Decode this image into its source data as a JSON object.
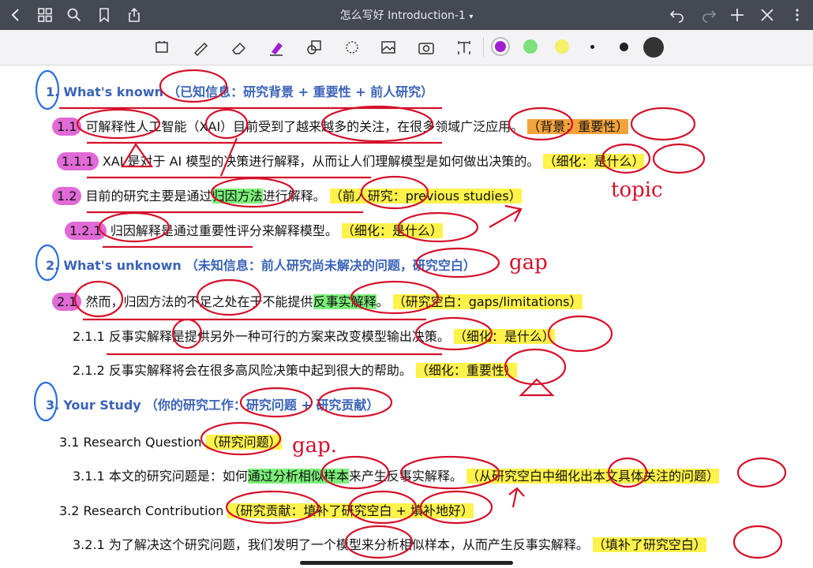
{
  "header": {
    "title": "怎么写好 Introduction-1",
    "colors": {
      "bar": "#454a52",
      "toolbar": "#f3f3f5"
    }
  },
  "toolbar": {
    "left_icons": [
      "back-icon",
      "grid-icon",
      "search-icon",
      "bookmark-icon",
      "share-icon"
    ],
    "right_icons": [
      "undo-icon",
      "redo-icon",
      "add-icon",
      "close-edit-icon"
    ],
    "tools": [
      "lasso-icon",
      "pen-icon",
      "eraser-icon",
      "highlighter-icon",
      "shapes-icon",
      "select-icon",
      "image-icon",
      "camera-icon",
      "text-icon"
    ],
    "swatches": [
      "#a020d0",
      "#7ee07a",
      "#f5ef6a",
      "#222222",
      "#222222",
      "#222222"
    ]
  },
  "content": {
    "s1": {
      "heading_num": "1.",
      "heading_en": "What's known",
      "heading_zh": "（已知信息：研究背景 + 重要性 + 前人研究）",
      "l1_num": "1.1",
      "l1_text": "可解释性人工智能（XAI）目前受到了越来越多的关注，在很多领域广泛应用。",
      "l1_tag": "（背景：重要性）",
      "l2_num": "1.1.1",
      "l2_text": "XAI 是对于 AI 模型的决策进行解释，从而让人们理解模型是如何做出决策的。",
      "l2_tag": "（细化：是什么）",
      "l3_num": "1.2",
      "l3_pre": "目前的研究主要是通过",
      "l3_hl": "归因方法",
      "l3_post": "进行解释。",
      "l3_tag": "（前人研究：previous studies）",
      "l4_num": "1.2.1",
      "l4_text": "归因解释是通过重要性评分来解释模型。",
      "l4_tag": "（细化：是什么）"
    },
    "s2": {
      "heading_num": "2.",
      "heading_en": "What's unknown",
      "heading_zh": "（未知信息：前人研究尚未解决的问题，研究空白）",
      "l1_num": "2.1",
      "l1_pre": "然而，归因方法的不足之处在于不能提供",
      "l1_hl": "反事实解释",
      "l1_post": "。",
      "l1_tag": "（研究空白：gaps/limitations）",
      "l2_num": "2.1.1",
      "l2_text": "反事实解释是提供另外一种可行的方案来改变模型输出决策。",
      "l2_tag": "（细化：是什么）",
      "l3_num": "2.1.2",
      "l3_text": "反事实解释将会在很多高风险决策中起到很大的帮助。",
      "l3_tag": "（细化：重要性）"
    },
    "s3": {
      "heading_num": "3.",
      "heading_en": "Your Study",
      "heading_zh": "（你的研究工作：研究问题 + 研究贡献）",
      "q_title": "3.1 Research Question",
      "q_tag": "（研究问题）",
      "q1_num": "3.1.1",
      "q1_pre": "本文的研究问题是：如何",
      "q1_hl": "通过分析相似样本",
      "q1_post": "来产生反事实解释。",
      "q1_tag": "（从研究空白中细化出本文具体关注的问题）",
      "c_title": "3.2 Research Contribution",
      "c_tag": "（研究贡献：填补了研究空白 + 填补地好）",
      "c1_num": "3.2.1",
      "c1_text": "为了解决这个研究问题，我们发明了一个模型来分析相似样本，从而产生反事实解释。",
      "c1_tag": "（填补了研究空白）"
    }
  },
  "handwriting": {
    "topic": "topic",
    "gap1": "gap",
    "gap2": "gap."
  }
}
